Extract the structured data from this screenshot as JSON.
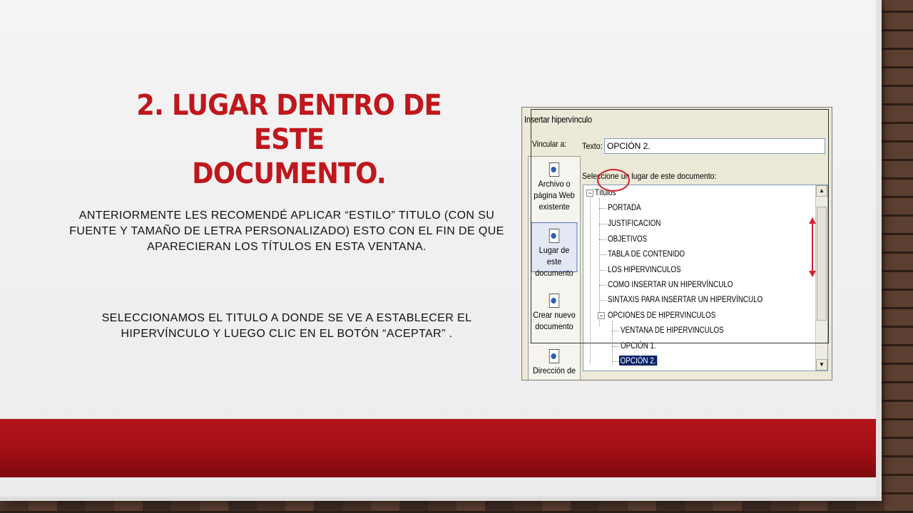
{
  "slide": {
    "title_line1": "2. LUGAR DENTRO DE ESTE",
    "title_line2": "DOCUMENTO.",
    "paragraph1": "ANTERIORMENTE LES RECOMENDÉ APLICAR “ESTILO” TITULO (CON SU FUENTE Y TAMAÑO DE LETRA PERSONALIZADO) ESTO CON EL FIN DE QUE APARECIERAN LOS TÍTULOS EN ESTA VENTANA.",
    "paragraph2": "SELECCIONAMOS EL TITULO A DONDE SE VE A ESTABLECER EL HIPERVÍNCULO Y LUEGO CLIC EN EL BOTÓN “ACEPTAR” ."
  },
  "colors": {
    "title": "#c0171c",
    "band": "#a10f15",
    "annotation": "#d0232a",
    "selection": "#0a246a"
  },
  "dialog": {
    "title": "Insertar hipervínculo",
    "link_to_label": "Vincular a:",
    "text_label": "Texto:",
    "text_value": "OPCIÓN 2.",
    "select_place_label": "Seleccione un lugar de este documento:",
    "sidebar": [
      {
        "label": "Archivo o página Web existente",
        "icon": "web-file-icon"
      },
      {
        "label": "Lugar de este documento",
        "icon": "place-in-document-icon"
      },
      {
        "label": "Crear nuevo documento",
        "icon": "new-document-icon"
      },
      {
        "label": "Dirección de",
        "icon": "email-address-icon"
      }
    ],
    "tree": {
      "root": "Títulos",
      "items": [
        "PORTADA",
        "JUSTIFICACION",
        "OBJETIVOS",
        "TABLA DE CONTENIDO",
        "LOS HIPERVINCULOS",
        "COMO INSERTAR UN HIPERVÍNCULO",
        "SINTAXIS PARA INSERTAR UN HIPERVÍNCULO"
      ],
      "group": "OPCIONES DE HIPERVINCULOS",
      "group_items": [
        "VENTANA DE HIPERVINCULOS",
        "OPCIÓN 1.",
        "OPCIÓN 2."
      ],
      "selected": "OPCIÓN 2."
    },
    "expand_symbol": "−"
  }
}
